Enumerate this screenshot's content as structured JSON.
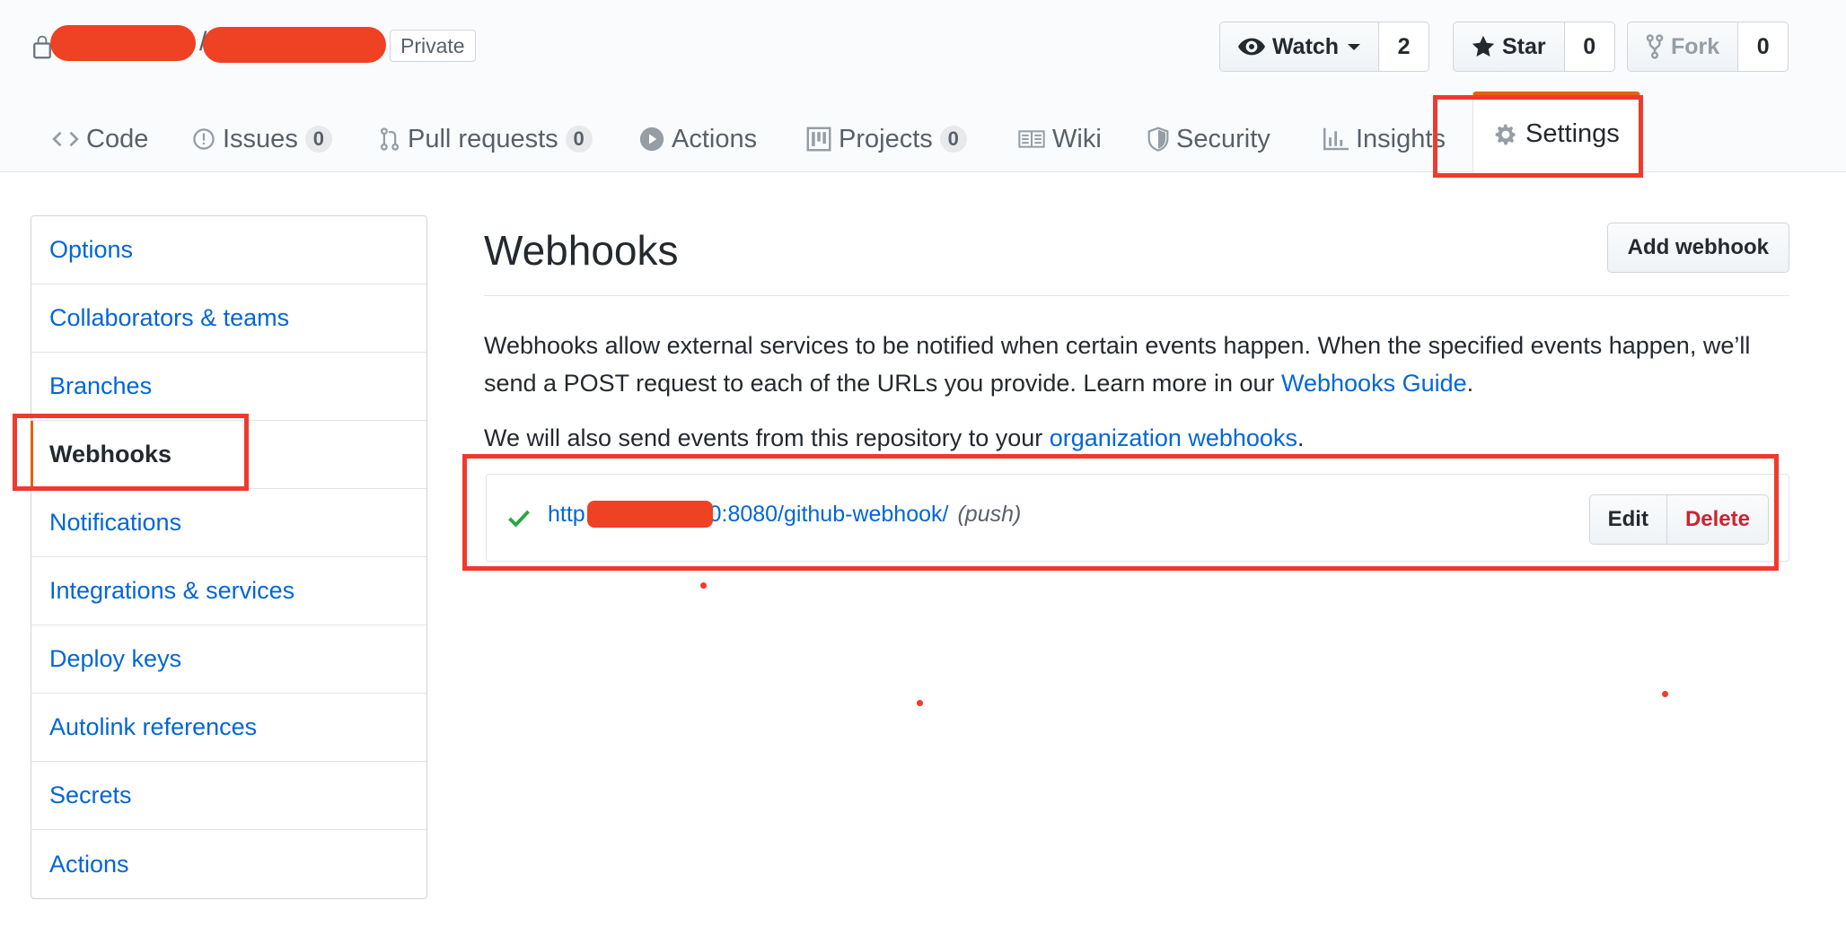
{
  "repo": {
    "visibility_label": "Private"
  },
  "actions": {
    "watch": {
      "label": "Watch",
      "count": "2"
    },
    "star": {
      "label": "Star",
      "count": "0"
    },
    "fork": {
      "label": "Fork",
      "count": "0"
    }
  },
  "tabs": [
    {
      "label": "Code",
      "icon": "code-icon"
    },
    {
      "label": "Issues",
      "icon": "issue-icon",
      "count": "0"
    },
    {
      "label": "Pull requests",
      "icon": "pull-request-icon",
      "count": "0"
    },
    {
      "label": "Actions",
      "icon": "play-icon"
    },
    {
      "label": "Projects",
      "icon": "project-icon",
      "count": "0"
    },
    {
      "label": "Wiki",
      "icon": "book-icon"
    },
    {
      "label": "Security",
      "icon": "shield-icon"
    },
    {
      "label": "Insights",
      "icon": "graph-icon"
    },
    {
      "label": "Settings",
      "icon": "gear-icon",
      "selected": true
    }
  ],
  "sidebar": {
    "items": [
      {
        "label": "Options"
      },
      {
        "label": "Collaborators & teams"
      },
      {
        "label": "Branches"
      },
      {
        "label": "Webhooks",
        "selected": true
      },
      {
        "label": "Notifications"
      },
      {
        "label": "Integrations & services"
      },
      {
        "label": "Deploy keys"
      },
      {
        "label": "Autolink references"
      },
      {
        "label": "Secrets"
      },
      {
        "label": "Actions"
      }
    ]
  },
  "main": {
    "title": "Webhooks",
    "add_button": "Add webhook",
    "description_part1": "Webhooks allow external services to be notified when certain events happen. When the specified events happen, we’ll send a POST request to each of the URLs you provide. Learn more in our ",
    "description_link": "Webhooks Guide",
    "description_end": ".",
    "org_text": "We will also send events from this repository to your ",
    "org_link": "organization webhooks",
    "org_end": ".",
    "hook": {
      "url_prefix": "http:/",
      "url_suffix": "0:8080/github-webhook/",
      "events": "(push)",
      "edit_label": "Edit",
      "delete_label": "Delete"
    }
  },
  "colors": {
    "accent_orange": "#e36209",
    "link_blue": "#0366d6",
    "annotation_red": "#ef3a2d",
    "danger_red": "#cb2431",
    "success_green": "#28a745"
  }
}
